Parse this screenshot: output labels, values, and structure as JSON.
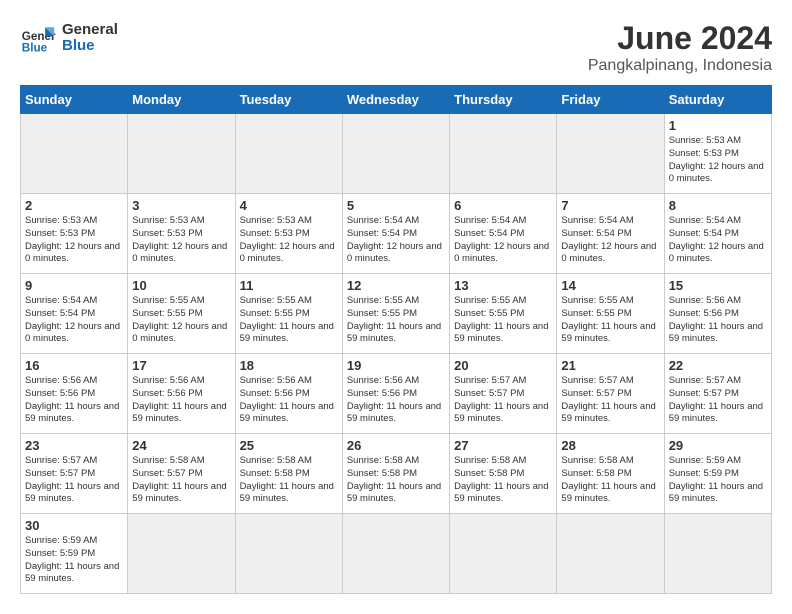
{
  "header": {
    "logo_general": "General",
    "logo_blue": "Blue",
    "title": "June 2024",
    "subtitle": "Pangkalpinang, Indonesia"
  },
  "weekdays": [
    "Sunday",
    "Monday",
    "Tuesday",
    "Wednesday",
    "Thursday",
    "Friday",
    "Saturday"
  ],
  "weeks": [
    [
      {
        "day": "",
        "info": ""
      },
      {
        "day": "",
        "info": ""
      },
      {
        "day": "",
        "info": ""
      },
      {
        "day": "",
        "info": ""
      },
      {
        "day": "",
        "info": ""
      },
      {
        "day": "",
        "info": ""
      },
      {
        "day": "1",
        "info": "Sunrise: 5:53 AM\nSunset: 5:53 PM\nDaylight: 12 hours and 0 minutes."
      }
    ],
    [
      {
        "day": "2",
        "info": "Sunrise: 5:53 AM\nSunset: 5:53 PM\nDaylight: 12 hours and 0 minutes."
      },
      {
        "day": "3",
        "info": "Sunrise: 5:53 AM\nSunset: 5:53 PM\nDaylight: 12 hours and 0 minutes."
      },
      {
        "day": "4",
        "info": "Sunrise: 5:53 AM\nSunset: 5:53 PM\nDaylight: 12 hours and 0 minutes."
      },
      {
        "day": "5",
        "info": "Sunrise: 5:54 AM\nSunset: 5:54 PM\nDaylight: 12 hours and 0 minutes."
      },
      {
        "day": "6",
        "info": "Sunrise: 5:54 AM\nSunset: 5:54 PM\nDaylight: 12 hours and 0 minutes."
      },
      {
        "day": "7",
        "info": "Sunrise: 5:54 AM\nSunset: 5:54 PM\nDaylight: 12 hours and 0 minutes."
      },
      {
        "day": "8",
        "info": "Sunrise: 5:54 AM\nSunset: 5:54 PM\nDaylight: 12 hours and 0 minutes."
      }
    ],
    [
      {
        "day": "9",
        "info": "Sunrise: 5:54 AM\nSunset: 5:54 PM\nDaylight: 12 hours and 0 minutes."
      },
      {
        "day": "10",
        "info": "Sunrise: 5:55 AM\nSunset: 5:55 PM\nDaylight: 12 hours and 0 minutes."
      },
      {
        "day": "11",
        "info": "Sunrise: 5:55 AM\nSunset: 5:55 PM\nDaylight: 11 hours and 59 minutes."
      },
      {
        "day": "12",
        "info": "Sunrise: 5:55 AM\nSunset: 5:55 PM\nDaylight: 11 hours and 59 minutes."
      },
      {
        "day": "13",
        "info": "Sunrise: 5:55 AM\nSunset: 5:55 PM\nDaylight: 11 hours and 59 minutes."
      },
      {
        "day": "14",
        "info": "Sunrise: 5:55 AM\nSunset: 5:55 PM\nDaylight: 11 hours and 59 minutes."
      },
      {
        "day": "15",
        "info": "Sunrise: 5:56 AM\nSunset: 5:56 PM\nDaylight: 11 hours and 59 minutes."
      }
    ],
    [
      {
        "day": "16",
        "info": "Sunrise: 5:56 AM\nSunset: 5:56 PM\nDaylight: 11 hours and 59 minutes."
      },
      {
        "day": "17",
        "info": "Sunrise: 5:56 AM\nSunset: 5:56 PM\nDaylight: 11 hours and 59 minutes."
      },
      {
        "day": "18",
        "info": "Sunrise: 5:56 AM\nSunset: 5:56 PM\nDaylight: 11 hours and 59 minutes."
      },
      {
        "day": "19",
        "info": "Sunrise: 5:56 AM\nSunset: 5:56 PM\nDaylight: 11 hours and 59 minutes."
      },
      {
        "day": "20",
        "info": "Sunrise: 5:57 AM\nSunset: 5:57 PM\nDaylight: 11 hours and 59 minutes."
      },
      {
        "day": "21",
        "info": "Sunrise: 5:57 AM\nSunset: 5:57 PM\nDaylight: 11 hours and 59 minutes."
      },
      {
        "day": "22",
        "info": "Sunrise: 5:57 AM\nSunset: 5:57 PM\nDaylight: 11 hours and 59 minutes."
      }
    ],
    [
      {
        "day": "23",
        "info": "Sunrise: 5:57 AM\nSunset: 5:57 PM\nDaylight: 11 hours and 59 minutes."
      },
      {
        "day": "24",
        "info": "Sunrise: 5:58 AM\nSunset: 5:57 PM\nDaylight: 11 hours and 59 minutes."
      },
      {
        "day": "25",
        "info": "Sunrise: 5:58 AM\nSunset: 5:58 PM\nDaylight: 11 hours and 59 minutes."
      },
      {
        "day": "26",
        "info": "Sunrise: 5:58 AM\nSunset: 5:58 PM\nDaylight: 11 hours and 59 minutes."
      },
      {
        "day": "27",
        "info": "Sunrise: 5:58 AM\nSunset: 5:58 PM\nDaylight: 11 hours and 59 minutes."
      },
      {
        "day": "28",
        "info": "Sunrise: 5:58 AM\nSunset: 5:58 PM\nDaylight: 11 hours and 59 minutes."
      },
      {
        "day": "29",
        "info": "Sunrise: 5:59 AM\nSunset: 5:59 PM\nDaylight: 11 hours and 59 minutes."
      }
    ],
    [
      {
        "day": "30",
        "info": "Sunrise: 5:59 AM\nSunset: 5:59 PM\nDaylight: 11 hours and 59 minutes."
      },
      {
        "day": "",
        "info": ""
      },
      {
        "day": "",
        "info": ""
      },
      {
        "day": "",
        "info": ""
      },
      {
        "day": "",
        "info": ""
      },
      {
        "day": "",
        "info": ""
      },
      {
        "day": "",
        "info": ""
      }
    ]
  ]
}
